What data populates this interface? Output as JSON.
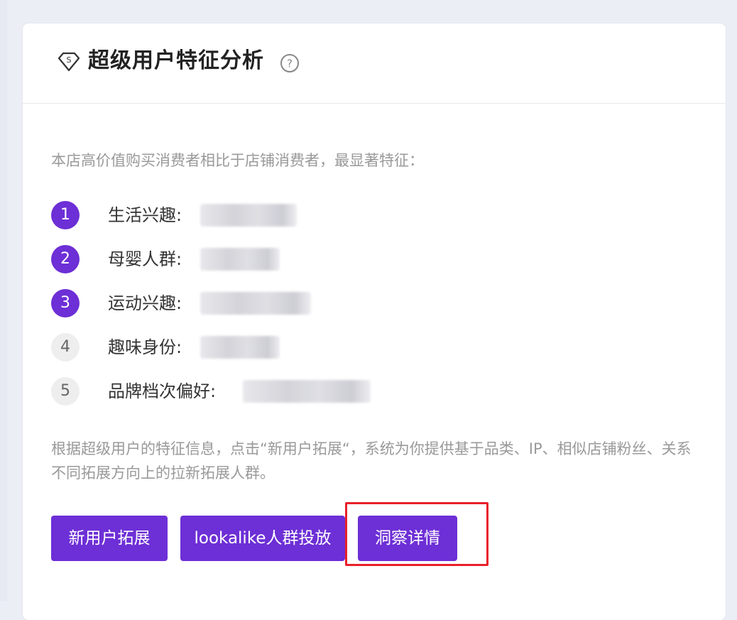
{
  "card": {
    "title": "超级用户特征分析",
    "intro": "本店高价值购买消费者相比于店铺消费者，最显著特征：",
    "features": [
      {
        "rank": "1",
        "label": "生活兴趣:"
      },
      {
        "rank": "2",
        "label": "母婴人群:"
      },
      {
        "rank": "3",
        "label": "运动兴趣:"
      },
      {
        "rank": "4",
        "label": "趣味身份:"
      },
      {
        "rank": "5",
        "label": "品牌档次偏好:"
      }
    ],
    "description": "根据超级用户的特征信息，点击“新用户拓展“，系统为你提供基于品类、IP、相似店铺粉丝、关系不同拓展方向上的拉新拓展人群。",
    "buttons": {
      "new_user": "新用户拓展",
      "lookalike": "lookalike人群投放",
      "insight": "洞察详情"
    }
  },
  "colors": {
    "accent": "#6d2fd6",
    "highlight": "#e8202a"
  },
  "icons": {
    "header": "diamond-badge-icon",
    "help": "help-circle-icon"
  }
}
